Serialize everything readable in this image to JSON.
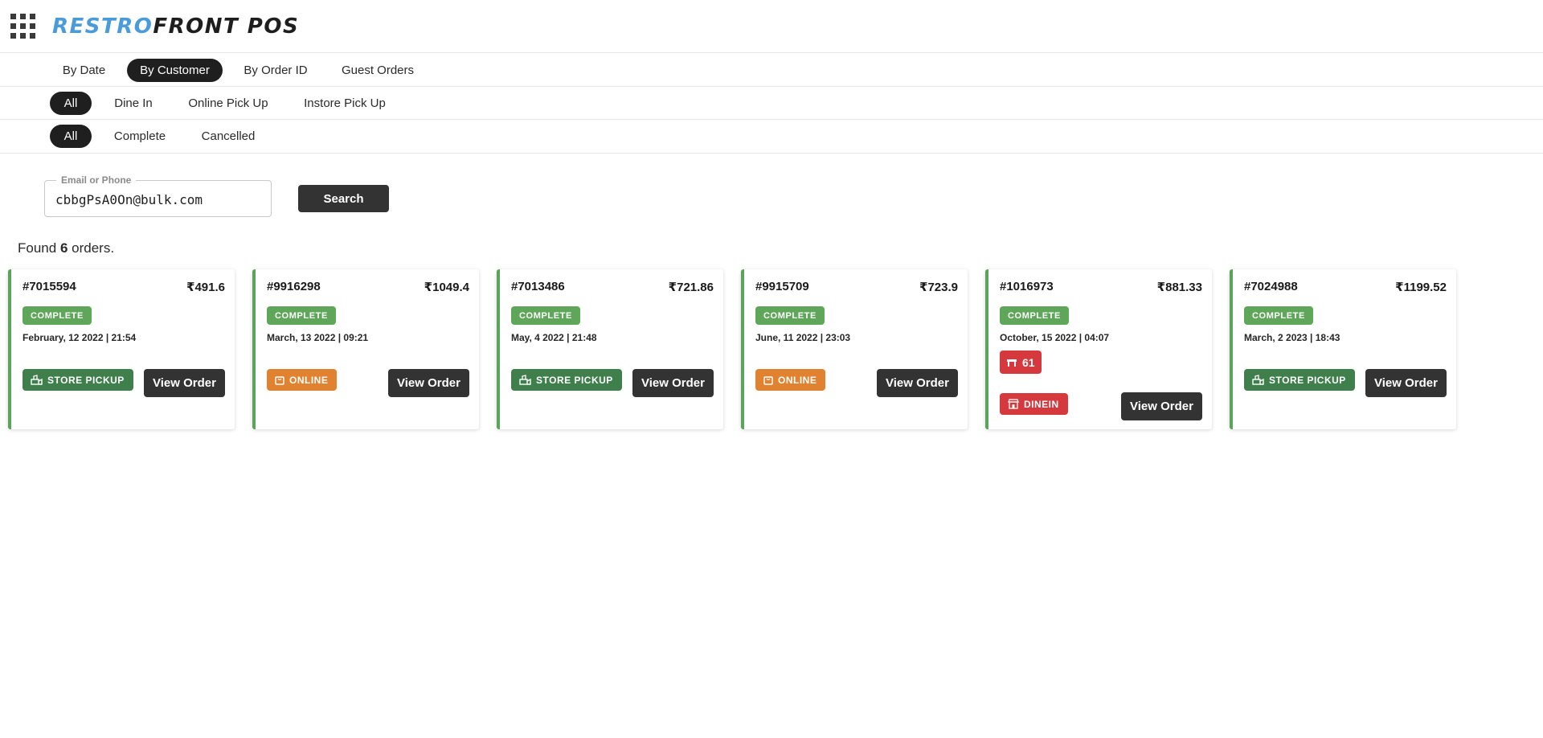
{
  "header": {
    "logo_part1": "RESTRO",
    "logo_part2": "FRONT POS",
    "menu_icon": "grid-icon"
  },
  "search_mode_tabs": [
    {
      "label": "By Date",
      "active": false
    },
    {
      "label": "By Customer",
      "active": true
    },
    {
      "label": "By Order ID",
      "active": false
    },
    {
      "label": "Guest Orders",
      "active": false
    }
  ],
  "order_type_filters": [
    {
      "label": "All",
      "active": true
    },
    {
      "label": "Dine In",
      "active": false
    },
    {
      "label": "Online Pick Up",
      "active": false
    },
    {
      "label": "Instore Pick Up",
      "active": false
    }
  ],
  "status_filters": [
    {
      "label": "All",
      "active": true
    },
    {
      "label": "Complete",
      "active": false
    },
    {
      "label": "Cancelled",
      "active": false
    }
  ],
  "search": {
    "label": "Email or Phone",
    "value": "cbbgPsA0On@bulk.com",
    "button_label": "Search"
  },
  "results": {
    "prefix": "Found",
    "count": "6",
    "suffix": "orders."
  },
  "orders": [
    {
      "id": "#7015594",
      "amount": "₹491.6",
      "status": "COMPLETE",
      "date": "February, 12 2022 | 21:54",
      "type": "STORE PICKUP",
      "button": "View Order"
    },
    {
      "id": "#9916298",
      "amount": "₹1049.4",
      "status": "COMPLETE",
      "date": "March, 13 2022 | 09:21",
      "type": "ONLINE",
      "button": "View Order"
    },
    {
      "id": "#7013486",
      "amount": "₹721.86",
      "status": "COMPLETE",
      "date": "May, 4 2022 | 21:48",
      "type": "STORE PICKUP",
      "button": "View Order"
    },
    {
      "id": "#9915709",
      "amount": "₹723.9",
      "status": "COMPLETE",
      "date": "June, 11 2022 | 23:03",
      "type": "ONLINE",
      "button": "View Order"
    },
    {
      "id": "#1016973",
      "amount": "₹881.33",
      "status": "COMPLETE",
      "date": "October, 15 2022 | 04:07",
      "table": "61",
      "type": "DINEIN",
      "button": "View Order"
    },
    {
      "id": "#7024988",
      "amount": "₹1199.52",
      "status": "COMPLETE",
      "date": "March, 2 2023 | 18:43",
      "type": "STORE PICKUP",
      "button": "View Order"
    }
  ],
  "colors": {
    "accent_complete": "#5fa55a",
    "store_pickup": "#3f7f4c",
    "online": "#e0822f",
    "dinein": "#d5383d",
    "button_dark": "#333333"
  }
}
